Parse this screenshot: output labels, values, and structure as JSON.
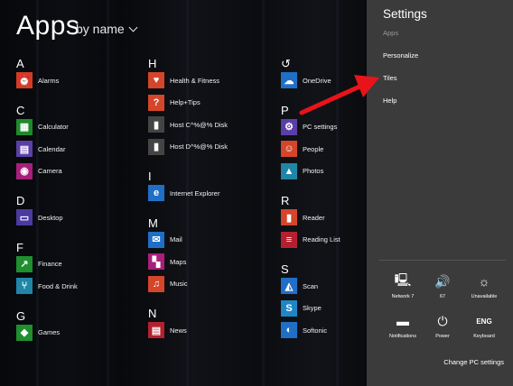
{
  "apps": {
    "title": "Apps",
    "sort_label": "by name",
    "columns": [
      {
        "groups": [
          {
            "letter": "A",
            "items": [
              {
                "label": "Alarms",
                "icon": "alarm-icon",
                "color": "#d33b26"
              }
            ]
          },
          {
            "letter": "C",
            "items": [
              {
                "label": "Calculator",
                "icon": "calculator-icon",
                "color": "#1e8a2a"
              },
              {
                "label": "Calendar",
                "icon": "calendar-icon",
                "color": "#5b3ea8"
              },
              {
                "label": "Camera",
                "icon": "camera-icon",
                "color": "#a81f7a"
              }
            ]
          },
          {
            "letter": "D",
            "items": [
              {
                "label": "Desktop",
                "icon": "desktop-icon",
                "color": "#4b3aa0"
              }
            ]
          },
          {
            "letter": "F",
            "items": [
              {
                "label": "Finance",
                "icon": "finance-icon",
                "color": "#1f8f30"
              },
              {
                "label": "Food & Drink",
                "icon": "food-drink-icon",
                "color": "#1f86a8"
              }
            ]
          },
          {
            "letter": "G",
            "items": [
              {
                "label": "Games",
                "icon": "games-icon",
                "color": "#1f8f30"
              }
            ]
          }
        ]
      },
      {
        "groups": [
          {
            "letter": "H",
            "items": [
              {
                "label": "Health & Fitness",
                "icon": "heart-icon",
                "color": "#d4452a"
              },
              {
                "label": "Help+Tips",
                "icon": "help-icon",
                "color": "#d4452a"
              },
              {
                "label": "Host C^%@% Disk",
                "icon": "folder-icon",
                "color": "#444444"
              },
              {
                "label": "Host D^%@% Disk",
                "icon": "folder-icon",
                "color": "#444444"
              }
            ]
          },
          {
            "letter": "I",
            "items": [
              {
                "label": "Internet Explorer",
                "icon": "internet-explorer-icon",
                "color": "#1f6fc6"
              }
            ]
          },
          {
            "letter": "M",
            "items": [
              {
                "label": "Mail",
                "icon": "mail-icon",
                "color": "#1f6fc6"
              },
              {
                "label": "Maps",
                "icon": "maps-icon",
                "color": "#a81f7a"
              },
              {
                "label": "Music",
                "icon": "music-icon",
                "color": "#d4452a"
              }
            ]
          },
          {
            "letter": "N",
            "items": [
              {
                "label": "News",
                "icon": "news-icon",
                "color": "#b5202f"
              }
            ]
          }
        ]
      },
      {
        "groups": [
          {
            "letter": "↺",
            "items": [
              {
                "label": "OneDrive",
                "icon": "cloud-icon",
                "color": "#1f6fc6"
              }
            ]
          },
          {
            "letter": "P",
            "items": [
              {
                "label": "PC settings",
                "icon": "gear-icon",
                "color": "#5b3ea8"
              },
              {
                "label": "People",
                "icon": "people-icon",
                "color": "#d4452a"
              },
              {
                "label": "Photos",
                "icon": "photos-icon",
                "color": "#1f86a8"
              }
            ]
          },
          {
            "letter": "R",
            "items": [
              {
                "label": "Reader",
                "icon": "reader-icon",
                "color": "#d4452a"
              },
              {
                "label": "Reading List",
                "icon": "reading-list-icon",
                "color": "#b5202f"
              }
            ]
          },
          {
            "letter": "S",
            "items": [
              {
                "label": "Scan",
                "icon": "scan-icon",
                "color": "#1f6fc6"
              },
              {
                "label": "Skype",
                "icon": "skype-icon",
                "color": "#1f86c6"
              },
              {
                "label": "Softonic",
                "icon": "softonic-icon",
                "color": "#1f6fc6"
              }
            ]
          }
        ]
      }
    ]
  },
  "settings": {
    "title": "Settings",
    "items": [
      {
        "label": "Apps",
        "dim": true
      },
      {
        "label": "Personalize",
        "dim": false
      },
      {
        "label": "Tiles",
        "dim": false
      },
      {
        "label": "Help",
        "dim": false
      }
    ],
    "quick": [
      {
        "label": "Network  7",
        "icon": "network-icon",
        "glyph": "🖳"
      },
      {
        "label": "67",
        "icon": "volume-icon",
        "glyph": "🔊"
      },
      {
        "label": "Unavailable",
        "icon": "brightness-icon",
        "glyph": "☼"
      },
      {
        "label": "Notifications",
        "icon": "notifications-icon",
        "glyph": "▬"
      },
      {
        "label": "Power",
        "icon": "power-icon",
        "glyph": "⏻"
      },
      {
        "label": "Keyboard",
        "icon": "keyboard-icon",
        "glyph": "ENG"
      }
    ],
    "change_label": "Change PC settings"
  },
  "annotation_color": "#e8141a"
}
